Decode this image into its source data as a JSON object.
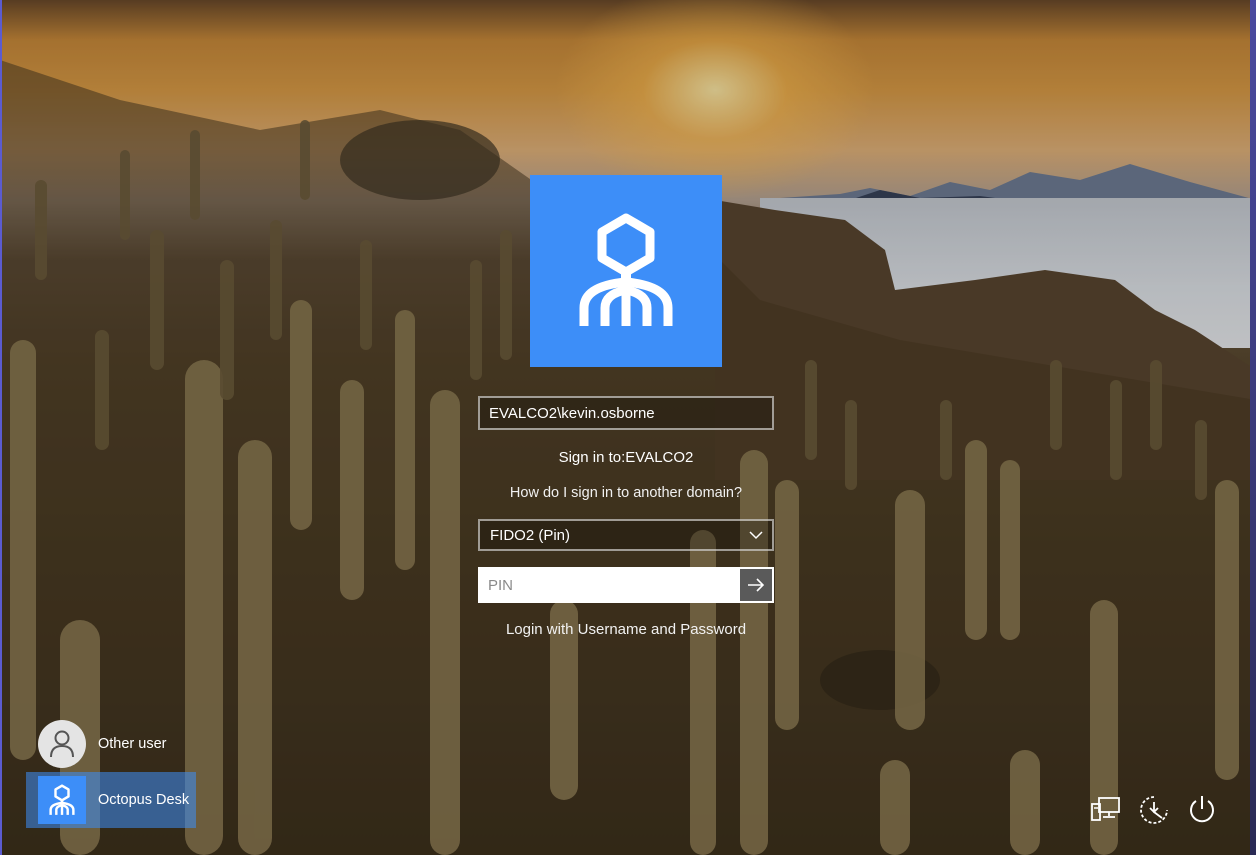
{
  "login": {
    "username": "EVALCO2\\kevin.osborne",
    "sign_in_to": "Sign in to:EVALCO2",
    "domain_help": "How do I sign in to another domain?",
    "provider": "FIDO2 (Pin)",
    "pin_placeholder": "PIN",
    "alt_login": "Login with Username and Password"
  },
  "users": [
    {
      "label": "Other user",
      "icon": "person-icon"
    },
    {
      "label": "Octopus Desk",
      "icon": "octopus-logo-icon",
      "selected": true
    }
  ],
  "system_icons": [
    "network-icon",
    "accessibility-icon",
    "power-icon"
  ],
  "colors": {
    "accent": "#3d8ef8"
  }
}
